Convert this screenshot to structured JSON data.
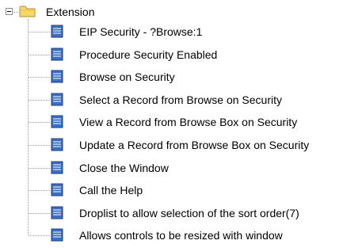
{
  "tree": {
    "root": {
      "label": "Extension",
      "icon": "folder-open-icon",
      "expanded": true,
      "expander_icon": "minus-icon"
    },
    "children": [
      {
        "label": "EIP Security - ?Browse:1",
        "icon": "document-icon"
      },
      {
        "label": "Procedure Security Enabled",
        "icon": "document-icon"
      },
      {
        "label": "Browse on Security",
        "icon": "document-icon"
      },
      {
        "label": "Select a Record from Browse on Security",
        "icon": "document-icon"
      },
      {
        "label": "View a Record from Browse Box on Security",
        "icon": "document-icon"
      },
      {
        "label": "Update a Record from Browse Box on Security",
        "icon": "document-icon"
      },
      {
        "label": "Close the Window",
        "icon": "document-icon"
      },
      {
        "label": "Call the Help",
        "icon": "document-icon"
      },
      {
        "label": "Droplist to allow selection of the sort order(7)",
        "icon": "document-icon"
      },
      {
        "label": "Allows controls to be resized with window",
        "icon": "document-icon"
      }
    ]
  },
  "colors": {
    "folder_fill": "#f7d66a",
    "folder_edge": "#b8902a",
    "doc_fill": "#3b6fc1",
    "doc_edge": "#1c3f7c",
    "connector": "#9a9a9a"
  }
}
